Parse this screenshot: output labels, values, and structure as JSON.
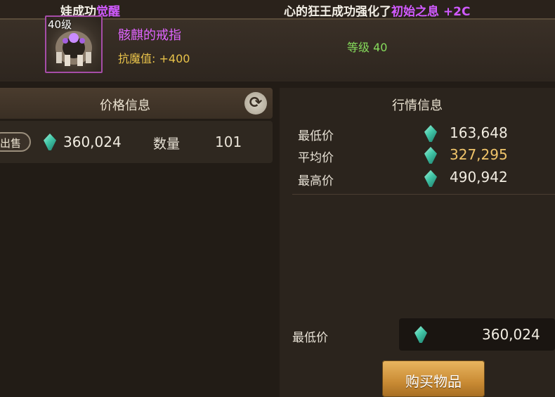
{
  "marquee": {
    "left_prefix": "娃成功",
    "left_highlight": "觉醒",
    "right_prefix": "心的狂王成功强化了",
    "right_highlight": "初始之息 +2C"
  },
  "item": {
    "level_badge": "40级",
    "name": "骸麒的戒指",
    "stat": "抗魔值: +400",
    "level": "等级 40",
    "icon": "ring-icon"
  },
  "price_panel": {
    "title": "价格信息",
    "sell_label": "出售",
    "price": "360,024",
    "qty_label": "数量",
    "qty_value": "101"
  },
  "market_panel": {
    "title": "行情信息",
    "rows": [
      {
        "label": "最低价",
        "value": "163,648"
      },
      {
        "label": "平均价",
        "value": "327,295"
      },
      {
        "label": "最高价",
        "value": "490,942"
      }
    ]
  },
  "purchase": {
    "label": "最低价",
    "value": "360,024",
    "buy_button": "购买物品"
  },
  "colors": {
    "highlight_purple": "#d05aff",
    "level_green": "#86dc5c",
    "stat_gold": "#e8c24a",
    "average_gold": "#f0c46a"
  }
}
